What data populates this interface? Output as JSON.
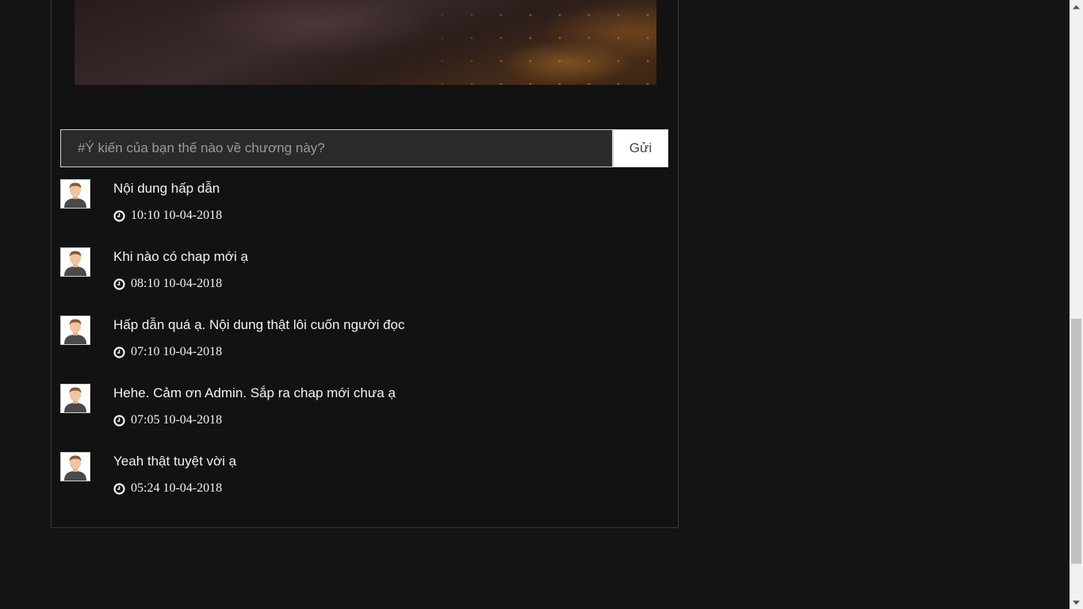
{
  "comment_form": {
    "placeholder": "#Ý kiến của bạn thế nào về chương này?",
    "send_label": "Gửi"
  },
  "comments": [
    {
      "text": "Nội dung hấp dẫn",
      "time": "10:10 10-04-2018",
      "avatar_icon": "user-avatar-icon",
      "time_icon": "clock-icon"
    },
    {
      "text": "Khi nào có chap mới ạ",
      "time": "08:10 10-04-2018",
      "avatar_icon": "user-avatar-icon",
      "time_icon": "clock-icon"
    },
    {
      "text": "Hấp dẫn quá ạ. Nội dung thật lôi cuốn người đọc",
      "time": "07:10 10-04-2018",
      "avatar_icon": "user-avatar-icon",
      "time_icon": "clock-icon"
    },
    {
      "text": "Hehe. Cảm ơn Admin. Sắp ra chap mới chưa ạ",
      "time": "07:05 10-04-2018",
      "avatar_icon": "user-avatar-icon",
      "time_icon": "clock-icon"
    },
    {
      "text": "Yeah thật tuyệt vời ạ",
      "time": "05:24 10-04-2018",
      "avatar_icon": "user-avatar-icon",
      "time_icon": "clock-icon"
    }
  ],
  "scrollbar": {
    "scroll_fraction": 0.52,
    "up_icon": "arrow-up-icon",
    "down_icon": "arrow-down-icon"
  },
  "colors": {
    "page_background": "#141414",
    "panel_background": "#121212",
    "text": "#f2f2f2",
    "input_background": "#2a2a2a",
    "button_background": "#ffffff"
  }
}
